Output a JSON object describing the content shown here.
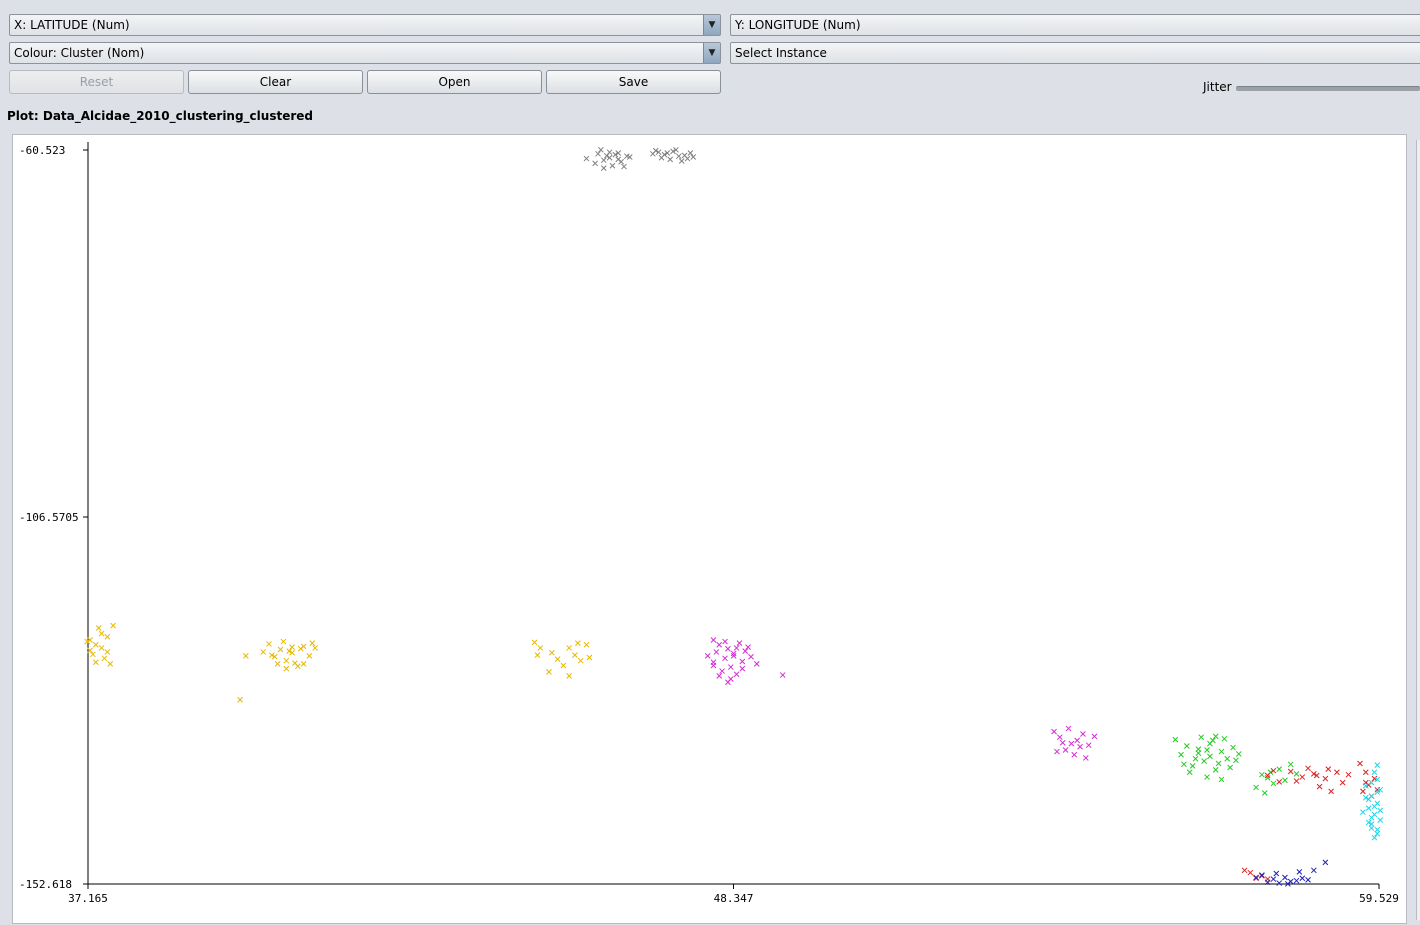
{
  "controls": {
    "x_axis_label": "X: LATITUDE (Num)",
    "y_axis_label": "Y: LONGITUDE (Num)",
    "colour_label": "Colour: Cluster (Nom)",
    "select_instance_label": "Select Instance",
    "reset_label": "Reset",
    "clear_label": "Clear",
    "open_label": "Open",
    "save_label": "Save",
    "jitter_label": "Jitter",
    "dropdown_arrow": "▼"
  },
  "plot": {
    "title": "Plot: Data_Alcidae_2010_clustering_clustered"
  },
  "chart_data": {
    "type": "scatter",
    "marker": "x",
    "xlim": [
      37.165,
      59.529
    ],
    "ylim": [
      -152.618,
      -60.523
    ],
    "x_ticks": [
      "37.165",
      "48.347",
      "59.529"
    ],
    "y_ticks": [
      "-60.523",
      "-106.5705",
      "-152.618"
    ],
    "grid": false,
    "clusters": [
      {
        "color": "#7f7f7f",
        "points": [
          [
            46.0,
            -61.0
          ],
          [
            46.2,
            -61.5
          ],
          [
            46.1,
            -61.8
          ],
          [
            46.35,
            -60.9
          ],
          [
            46.5,
            -61.3
          ],
          [
            45.95,
            -62.2
          ],
          [
            46.25,
            -62.5
          ],
          [
            46.4,
            -62.0
          ],
          [
            46.05,
            -60.5
          ],
          [
            46.3,
            -61.1
          ],
          [
            45.8,
            -61.6
          ],
          [
            46.55,
            -61.4
          ],
          [
            46.2,
            -60.8
          ],
          [
            46.1,
            -62.8
          ],
          [
            46.45,
            -62.6
          ],
          [
            46.35,
            -61.7
          ],
          [
            46.15,
            -61.25
          ]
        ]
      },
      {
        "color": "#7f7f7f",
        "points": [
          [
            47.0,
            -60.6
          ],
          [
            47.2,
            -60.9
          ],
          [
            47.4,
            -61.3
          ],
          [
            47.15,
            -61.1
          ],
          [
            47.55,
            -61.6
          ],
          [
            46.95,
            -61.0
          ],
          [
            47.3,
            -60.7
          ],
          [
            47.1,
            -61.5
          ],
          [
            47.45,
            -61.9
          ],
          [
            47.6,
            -60.9
          ],
          [
            47.35,
            -60.5
          ],
          [
            47.05,
            -60.8
          ],
          [
            47.25,
            -61.7
          ],
          [
            47.5,
            -61.2
          ],
          [
            47.65,
            -61.4
          ]
        ]
      },
      {
        "color": "#e6b800",
        "points": [
          [
            37.2,
            -122.0
          ],
          [
            37.3,
            -122.6
          ],
          [
            37.4,
            -123.0
          ],
          [
            37.25,
            -123.8
          ],
          [
            37.45,
            -124.3
          ],
          [
            37.3,
            -124.8
          ],
          [
            37.5,
            -121.6
          ],
          [
            37.35,
            -120.5
          ],
          [
            37.6,
            -120.2
          ],
          [
            37.2,
            -123.3
          ],
          [
            37.5,
            -123.5
          ],
          [
            37.15,
            -122.2
          ],
          [
            37.55,
            -125.0
          ],
          [
            37.4,
            -121.2
          ]
        ]
      },
      {
        "color": "#e6b800",
        "points": [
          [
            40.3,
            -122.5
          ],
          [
            40.5,
            -123.2
          ],
          [
            40.7,
            -123.6
          ],
          [
            40.9,
            -122.8
          ],
          [
            40.4,
            -124.1
          ],
          [
            40.6,
            -124.6
          ],
          [
            40.8,
            -125.3
          ],
          [
            41.0,
            -124.0
          ],
          [
            41.1,
            -123.0
          ],
          [
            40.55,
            -122.2
          ],
          [
            40.75,
            -124.9
          ],
          [
            40.35,
            -123.9
          ],
          [
            40.65,
            -123.4
          ],
          [
            40.9,
            -125.0
          ],
          [
            41.05,
            -122.4
          ],
          [
            39.9,
            -124.0
          ],
          [
            40.2,
            -123.5
          ],
          [
            39.8,
            -129.5
          ],
          [
            40.45,
            -125.0
          ],
          [
            40.85,
            -123.1
          ],
          [
            40.6,
            -125.6
          ],
          [
            40.7,
            -122.9
          ]
        ]
      },
      {
        "color": "#e6b800",
        "points": [
          [
            44.9,
            -122.3
          ],
          [
            45.0,
            -123.0
          ],
          [
            45.2,
            -123.6
          ],
          [
            45.3,
            -124.4
          ],
          [
            45.5,
            -123.0
          ],
          [
            45.6,
            -123.9
          ],
          [
            45.4,
            -125.2
          ],
          [
            45.8,
            -122.6
          ],
          [
            45.7,
            -124.6
          ],
          [
            45.15,
            -126.0
          ],
          [
            45.5,
            -126.5
          ],
          [
            44.95,
            -123.9
          ],
          [
            45.85,
            -124.2
          ],
          [
            45.65,
            -122.4
          ]
        ]
      },
      {
        "color": "#d42dd4",
        "points": [
          [
            48.0,
            -122.0
          ],
          [
            48.1,
            -122.6
          ],
          [
            48.25,
            -123.1
          ],
          [
            48.35,
            -123.7
          ],
          [
            48.2,
            -124.3
          ],
          [
            48.0,
            -124.8
          ],
          [
            48.3,
            -125.4
          ],
          [
            48.45,
            -122.4
          ],
          [
            48.55,
            -123.4
          ],
          [
            48.15,
            -125.9
          ],
          [
            48.4,
            -126.3
          ],
          [
            48.05,
            -123.5
          ],
          [
            47.9,
            -124.0
          ],
          [
            48.5,
            -124.7
          ],
          [
            48.6,
            -122.9
          ],
          [
            48.3,
            -126.9
          ],
          [
            48.2,
            -122.2
          ],
          [
            48.35,
            -124.0
          ],
          [
            48.5,
            -125.6
          ],
          [
            48.1,
            -126.5
          ],
          [
            48.25,
            -127.3
          ],
          [
            48.65,
            -124.1
          ],
          [
            48.75,
            -125.0
          ],
          [
            49.2,
            -126.4
          ],
          [
            48.4,
            -123.0
          ],
          [
            48.0,
            -125.2
          ]
        ]
      },
      {
        "color": "#d42dd4",
        "points": [
          [
            53.9,
            -133.5
          ],
          [
            54.0,
            -134.2
          ],
          [
            54.2,
            -135.0
          ],
          [
            54.1,
            -135.8
          ],
          [
            54.3,
            -134.6
          ],
          [
            54.4,
            -133.8
          ],
          [
            54.25,
            -136.4
          ],
          [
            54.5,
            -135.2
          ],
          [
            53.95,
            -136.0
          ],
          [
            54.35,
            -135.4
          ],
          [
            54.6,
            -134.1
          ],
          [
            54.15,
            -133.1
          ],
          [
            54.45,
            -136.8
          ],
          [
            54.05,
            -134.9
          ]
        ]
      },
      {
        "color": "#22cc22",
        "points": [
          [
            56.0,
            -134.5
          ],
          [
            56.2,
            -135.3
          ],
          [
            56.4,
            -136.2
          ],
          [
            56.6,
            -135.0
          ],
          [
            56.8,
            -136.0
          ],
          [
            56.5,
            -137.2
          ],
          [
            56.3,
            -137.8
          ],
          [
            56.7,
            -138.3
          ],
          [
            56.9,
            -136.9
          ],
          [
            57.0,
            -135.5
          ],
          [
            56.1,
            -136.4
          ],
          [
            56.45,
            -134.2
          ],
          [
            56.65,
            -134.6
          ],
          [
            56.85,
            -134.4
          ],
          [
            56.25,
            -138.6
          ],
          [
            56.55,
            -139.2
          ],
          [
            56.75,
            -137.5
          ],
          [
            57.05,
            -137.1
          ],
          [
            56.35,
            -136.9
          ],
          [
            56.95,
            -138.0
          ],
          [
            57.1,
            -136.3
          ],
          [
            56.15,
            -137.6
          ],
          [
            56.6,
            -136.6
          ],
          [
            56.4,
            -135.7
          ],
          [
            56.7,
            -134.1
          ],
          [
            56.55,
            -135.8
          ],
          [
            56.8,
            -139.5
          ]
        ]
      },
      {
        "color": "#22cc22",
        "points": [
          [
            57.4,
            -140.5
          ],
          [
            57.6,
            -139.3
          ],
          [
            57.8,
            -138.2
          ],
          [
            58.0,
            -137.6
          ],
          [
            57.5,
            -138.9
          ],
          [
            57.7,
            -140.0
          ],
          [
            57.9,
            -139.6
          ],
          [
            57.55,
            -141.2
          ],
          [
            58.1,
            -138.8
          ],
          [
            57.65,
            -138.6
          ]
        ]
      },
      {
        "color": "#e02020",
        "points": [
          [
            57.6,
            -139.0
          ],
          [
            57.8,
            -139.8
          ],
          [
            58.0,
            -138.5
          ],
          [
            58.2,
            -139.2
          ],
          [
            58.4,
            -138.8
          ],
          [
            58.6,
            -139.4
          ],
          [
            58.8,
            -138.6
          ],
          [
            58.9,
            -139.9
          ],
          [
            58.5,
            -140.4
          ],
          [
            58.3,
            -138.1
          ],
          [
            58.7,
            -141.0
          ],
          [
            59.0,
            -138.9
          ],
          [
            58.1,
            -139.7
          ],
          [
            57.7,
            -138.4
          ],
          [
            58.45,
            -139.0
          ],
          [
            58.65,
            -138.2
          ]
        ]
      },
      {
        "color": "#e02020",
        "points": [
          [
            59.2,
            -137.5
          ],
          [
            59.3,
            -138.6
          ],
          [
            59.45,
            -139.4
          ],
          [
            59.35,
            -140.2
          ],
          [
            59.5,
            -140.8
          ],
          [
            59.4,
            -141.6
          ],
          [
            59.3,
            -139.9
          ],
          [
            59.25,
            -141.0
          ]
        ]
      },
      {
        "color": "#22d4e6",
        "points": [
          [
            59.3,
            -140.3
          ],
          [
            59.4,
            -141.6
          ],
          [
            59.5,
            -142.5
          ],
          [
            59.35,
            -143.1
          ],
          [
            59.45,
            -143.9
          ],
          [
            59.55,
            -144.6
          ],
          [
            59.4,
            -145.1
          ],
          [
            59.5,
            -145.8
          ],
          [
            59.35,
            -142.0
          ],
          [
            59.5,
            -139.5
          ],
          [
            59.45,
            -138.6
          ],
          [
            59.55,
            -140.8
          ],
          [
            59.4,
            -144.3
          ],
          [
            59.5,
            -146.3
          ],
          [
            59.3,
            -141.8
          ],
          [
            59.45,
            -142.9
          ],
          [
            59.55,
            -143.4
          ],
          [
            59.4,
            -139.9
          ],
          [
            59.5,
            -137.7
          ],
          [
            59.35,
            -144.9
          ],
          [
            59.45,
            -146.8
          ],
          [
            59.25,
            -143.6
          ],
          [
            59.5,
            -141.1
          ],
          [
            59.4,
            -145.6
          ]
        ]
      },
      {
        "color": "#e02020",
        "points": [
          [
            57.3,
            -151.2
          ],
          [
            57.5,
            -151.6
          ],
          [
            57.4,
            -151.9
          ],
          [
            57.2,
            -150.9
          ],
          [
            57.6,
            -152.0
          ]
        ]
      },
      {
        "color": "#2020b4",
        "points": [
          [
            57.5,
            -151.5
          ],
          [
            57.7,
            -152.0
          ],
          [
            57.9,
            -151.8
          ],
          [
            58.1,
            -152.2
          ],
          [
            57.6,
            -152.4
          ],
          [
            57.8,
            -152.5
          ],
          [
            58.0,
            -152.3
          ],
          [
            58.2,
            -151.9
          ],
          [
            57.75,
            -151.3
          ],
          [
            57.95,
            -152.6
          ],
          [
            58.3,
            -152.1
          ],
          [
            58.15,
            -151.1
          ],
          [
            57.4,
            -151.8
          ],
          [
            58.4,
            -150.9
          ],
          [
            58.6,
            -149.9
          ]
        ]
      }
    ]
  }
}
